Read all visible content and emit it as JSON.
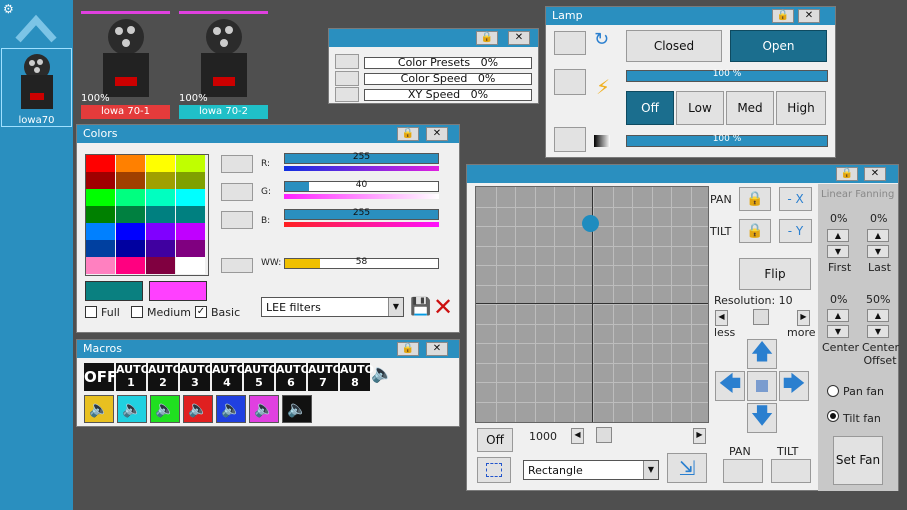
{
  "sidebar": {
    "item_label": "lowa70"
  },
  "fixtures": [
    {
      "label": "lowa 70-1",
      "pct": "100%",
      "color": "#e43b3b",
      "bar": "#e040e0"
    },
    {
      "label": "lowa 70-2",
      "pct": "100%",
      "color": "#20c0c8",
      "bar": "#e040e0"
    }
  ],
  "presets": {
    "rows": [
      {
        "label": "Color Presets",
        "value": "0%"
      },
      {
        "label": "Color Speed",
        "value": "0%"
      },
      {
        "label": "XY Speed",
        "value": "0%"
      }
    ]
  },
  "lamp": {
    "title": "Lamp",
    "closed": "Closed",
    "open": "Open",
    "bar1": "100 %",
    "bar1_level": 1.0,
    "off": "Off",
    "low": "Low",
    "med": "Med",
    "high": "High",
    "bar2": "100 %",
    "bar2_level": 1.0
  },
  "colors": {
    "title": "Colors",
    "r_label": "R:",
    "r": "255",
    "r_level": 1.0,
    "g_label": "G:",
    "g": "40",
    "g_level": 0.157,
    "b_label": "B:",
    "b": "255",
    "b_level": 1.0,
    "ww_label": "WW:",
    "ww": "58",
    "ww_level": 0.227,
    "full": "Full",
    "medium": "Medium",
    "basic": "Basic",
    "filter": "LEE filters",
    "check": "✓",
    "grid": [
      "#ff0000",
      "#ff8000",
      "#ffff00",
      "#c0ff00",
      "#a00000",
      "#a04000",
      "#a0a000",
      "#80a000",
      "#00ff00",
      "#00ff80",
      "#00ffc0",
      "#00ffff",
      "#008000",
      "#008040",
      "#008080",
      "#008080",
      "#0080ff",
      "#0000ff",
      "#8000ff",
      "#c000ff",
      "#0040a0",
      "#0000a0",
      "#4000a0",
      "#800080",
      "#ff80c0",
      "#ff0080",
      "#800040",
      "#ffffff"
    ],
    "swatch_a": "#0a8080",
    "swatch_b": "#ff40ff"
  },
  "macros": {
    "title": "Macros",
    "off": "OFF",
    "autos": [
      "AUTO 1",
      "AUTO 2",
      "AUTO 3",
      "AUTO 4",
      "AUTO 5",
      "AUTO 6",
      "AUTO 7",
      "AUTO 8"
    ],
    "speaker_colors": [
      "#e8c020",
      "#20d0e0",
      "#20e020",
      "#e02020",
      "#2040e0",
      "#e040e0",
      "#111111"
    ]
  },
  "xy": {
    "pan": "PAN",
    "tilt": "TILT",
    "minus_x": "- X",
    "minus_y": "- Y",
    "flip": "Flip",
    "resolution": "Resolution: 10",
    "less": "less",
    "more": "more",
    "off": "Off",
    "speed": "1000",
    "shape": "Rectangle",
    "pan2": "PAN",
    "tilt2": "TILT",
    "dot_x": 0.49,
    "dot_y": 0.155
  },
  "fan": {
    "title": "Linear Fanning",
    "first_pct": "0%",
    "last_pct": "0%",
    "first": "First",
    "last": "Last",
    "center_pct": "0%",
    "offset_pct": "50%",
    "center": "Center",
    "center_offset": "Center Offset",
    "pan_fan": "Pan fan",
    "tilt_fan": "Tilt fan",
    "set_fan": "Set Fan"
  },
  "icons": {
    "lock": "🔒",
    "close": "✖",
    "save": "💾",
    "x": "✕",
    "up": "🡅",
    "down": "🡇",
    "left": "🡄",
    "right": "🡆",
    "gear": "⚙",
    "chevron": "︿",
    "speaker": "🔈",
    "bolt": "⚡",
    "rotate": "↻",
    "swap": "⇲",
    "box": "⬚",
    "tri_left": "◀",
    "tri_right": "▶",
    "tri_up": "▲",
    "tri_down": "▼",
    "dropdown": "▼"
  }
}
